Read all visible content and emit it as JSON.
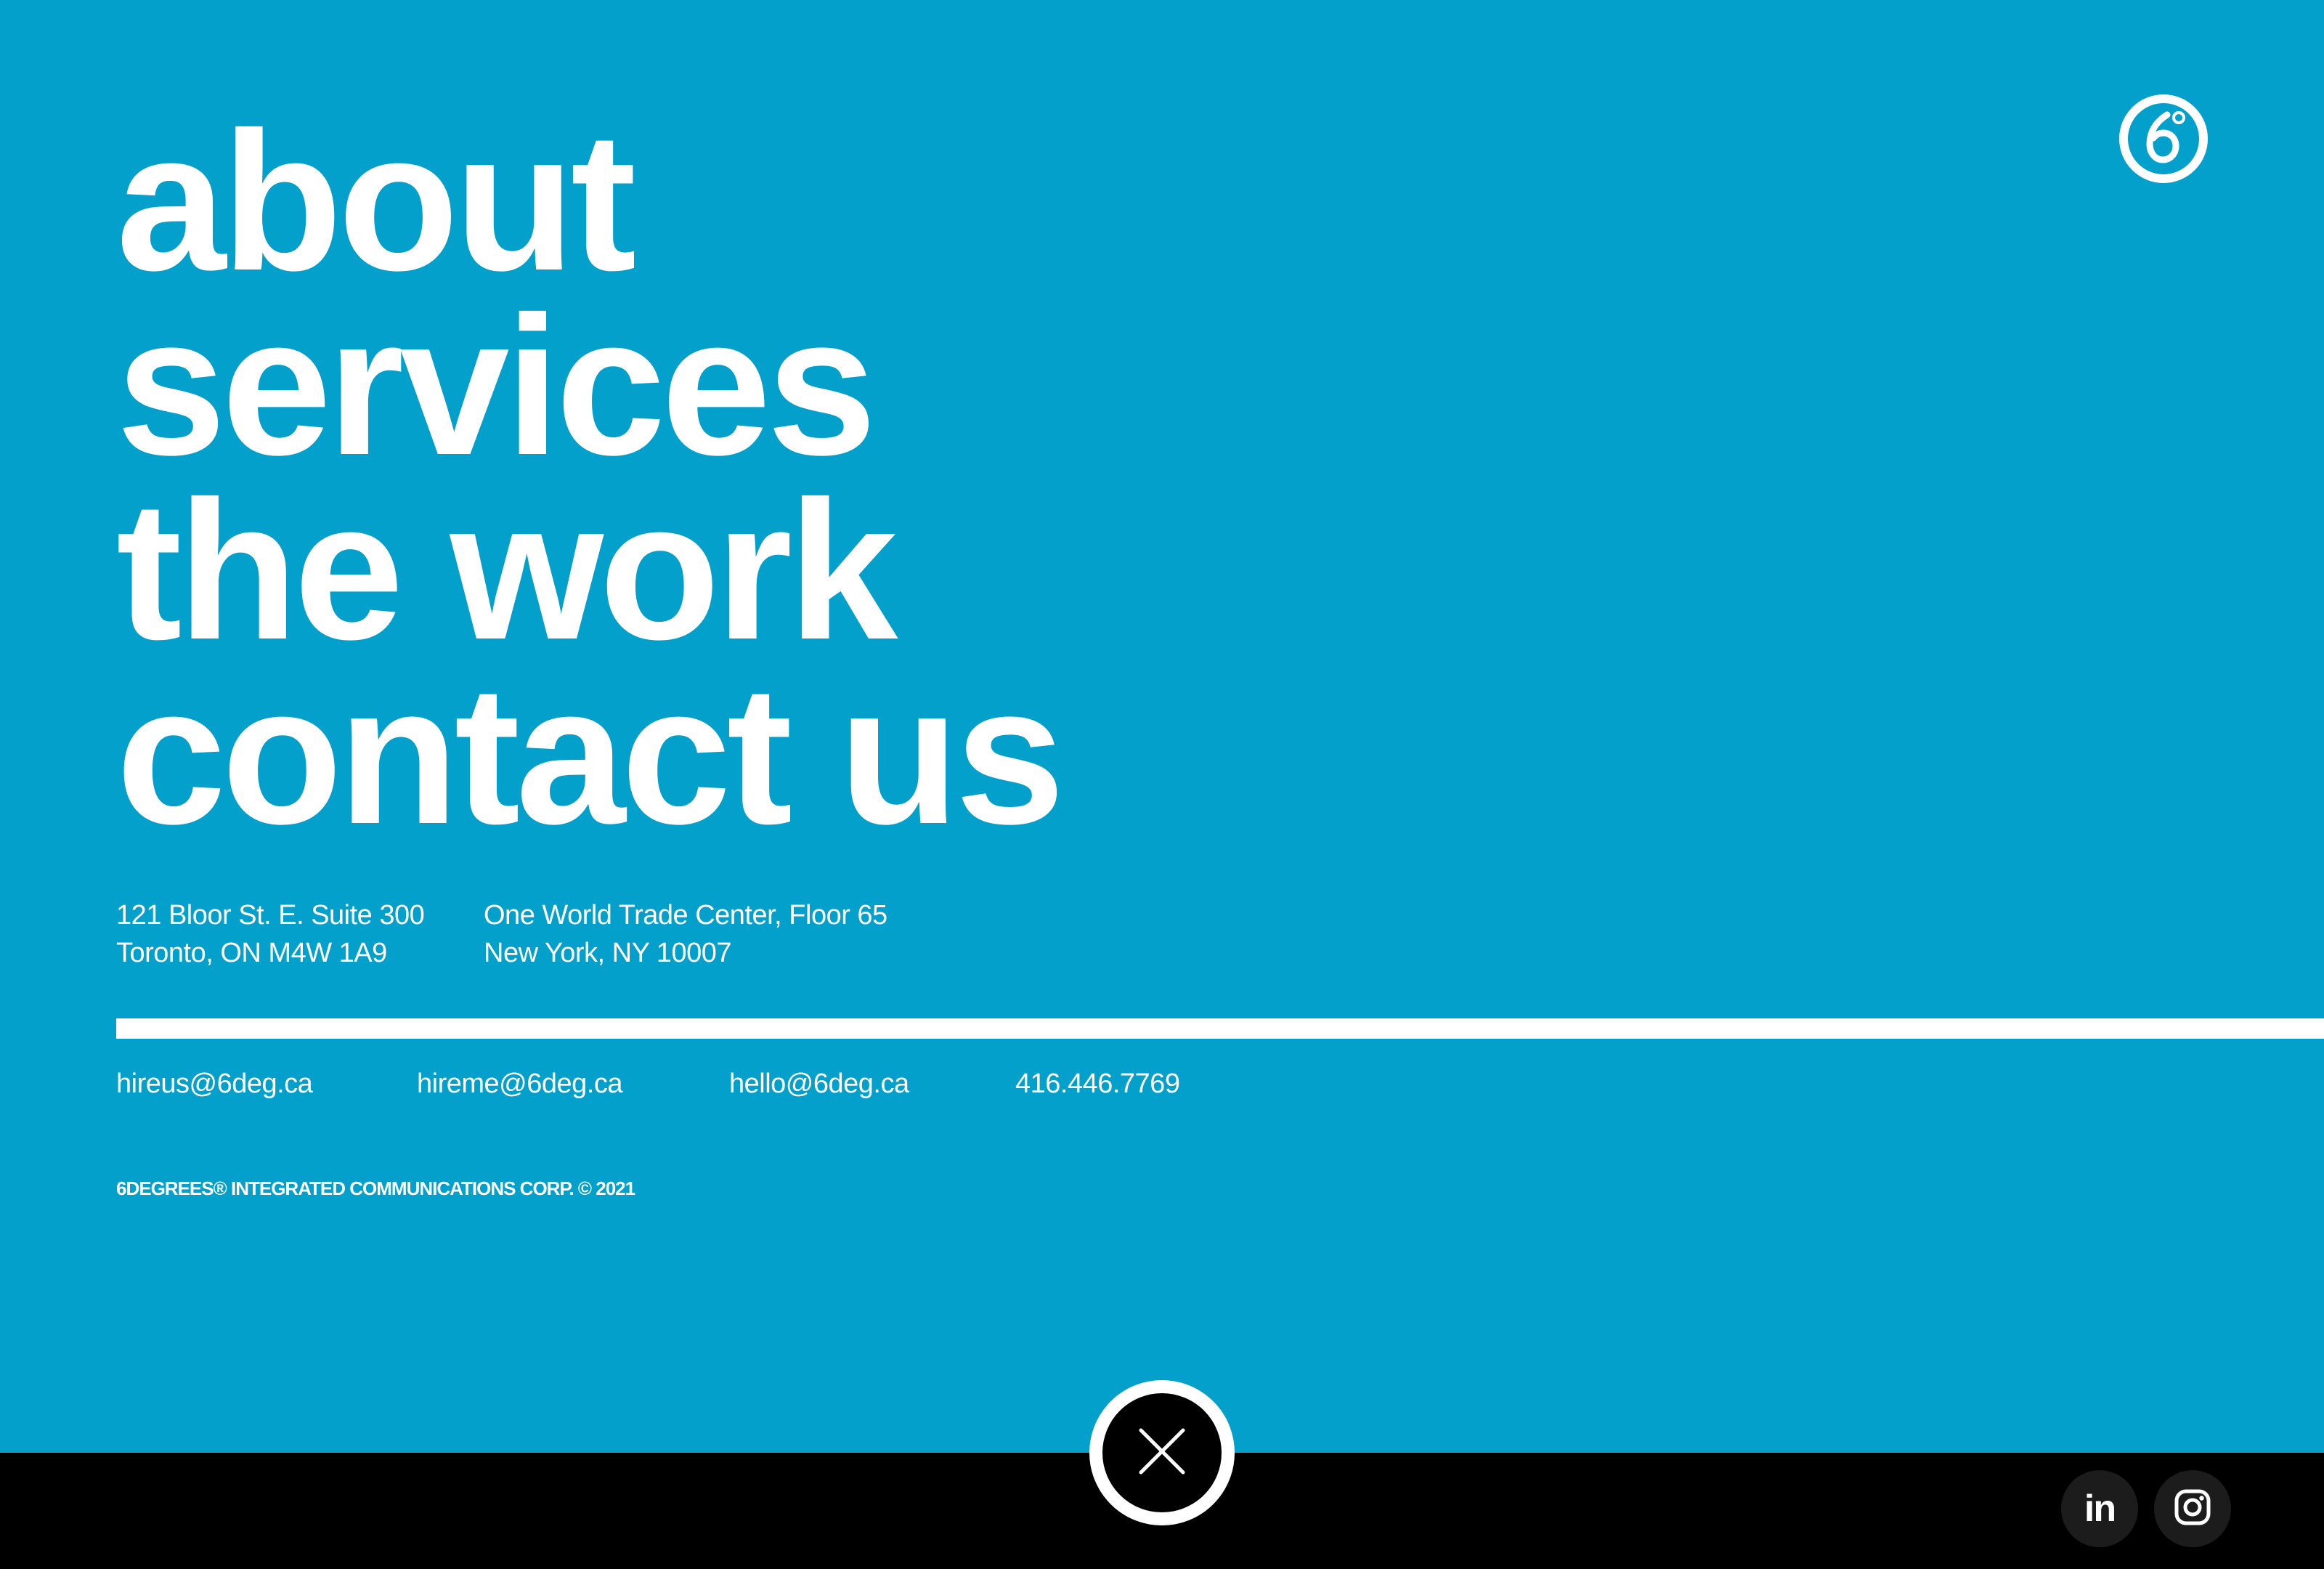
{
  "nav": {
    "items": [
      {
        "label": "about"
      },
      {
        "label": "services"
      },
      {
        "label": "the work"
      },
      {
        "label": "contact us"
      }
    ]
  },
  "logo": {
    "icon": "six-degrees-logo-icon"
  },
  "addresses": {
    "toronto": {
      "line1": "121 Bloor St. E. Suite 300",
      "line2": "Toronto, ON  M4W 1A9"
    },
    "new_york": {
      "line1": "One World Trade Center, Floor 65",
      "line2": "New York, NY 10007"
    }
  },
  "contacts": {
    "email_hireus": "hireus@6deg.ca",
    "email_hireme": "hireme@6deg.ca",
    "email_hello": "hello@6deg.ca",
    "phone": "416.446.7769"
  },
  "copyright": "6DEGREES® INTEGRATED COMMUNICATIONS CORP. © 2021",
  "close_button": {
    "icon": "close-icon"
  },
  "social": {
    "linkedin": {
      "icon": "linkedin-icon",
      "glyph": "in"
    },
    "instagram": {
      "icon": "instagram-icon"
    }
  },
  "colors": {
    "background": "#02a0cb",
    "text": "#ffffff",
    "footer": "#000000",
    "social_button": "#1c1c1c"
  }
}
